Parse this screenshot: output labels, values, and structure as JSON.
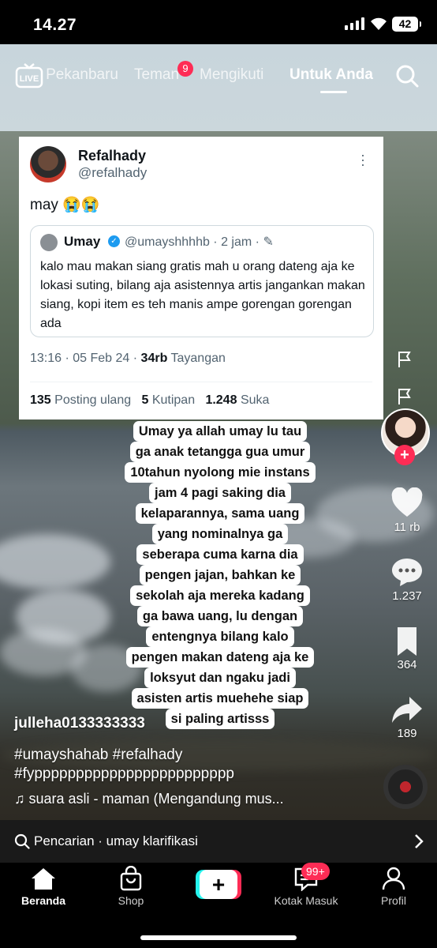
{
  "status": {
    "time": "14.27",
    "battery": "42"
  },
  "top_nav": {
    "live_label": "LIVE",
    "tabs": [
      {
        "label": "Pekanbaru"
      },
      {
        "label": "Teman",
        "badge": "9"
      },
      {
        "label": "Mengikuti"
      },
      {
        "label": "Untuk Anda",
        "active": true
      }
    ]
  },
  "tweet": {
    "name": "Refalhady",
    "handle": "@refalhady",
    "text": "may 😭😭",
    "quote": {
      "name": "Umay",
      "meta": "@umayshhhhb · 2 jam ·",
      "body": "kalo mau makan siang gratis mah u orang dateng aja ke lokasi suting, bilang aja asistennya artis jangankan makan siang, kopi item es teh manis ampe gorengan gorengan ada"
    },
    "time": "13:16 · 05 Feb 24 ·",
    "views_count": "34rb",
    "views_label": "Tayangan",
    "reposts_count": "135",
    "reposts_label": "Posting ulang",
    "quotes_count": "5",
    "quotes_label": "Kutipan",
    "likes_count": "1.248",
    "likes_label": "Suka"
  },
  "caption_lines": [
    "Umay ya allah umay lu tau",
    "ga anak tetangga gua umur",
    "10tahun nyolong mie instans",
    "jam 4 pagi saking dia",
    "kelaparannya, sama uang",
    "yang nominalnya ga",
    "seberapa cuma karna dia",
    "pengen jajan, bahkan ke",
    "sekolah aja mereka kadang",
    "ga bawa uang, lu dengan",
    "entengnya bilang kalo",
    "pengen makan dateng aja ke",
    "loksyut dan ngaku jadi",
    "asisten artis muehehe siap",
    "si paling artisss"
  ],
  "actions": {
    "likes": "11 rb",
    "comments": "1.237",
    "saves": "364",
    "shares": "189"
  },
  "video": {
    "username": "julleha0133333333",
    "hashtags_line1": "#umayshahab #refalhady",
    "hashtags_line2": "#fypppppppppppppppppppppppp",
    "music": "♫ suara asli - maman (Mengandung mus..."
  },
  "search_bar": {
    "text": "Pencarian · umay klarifikasi"
  },
  "bottom_nav": {
    "home": "Beranda",
    "shop": "Shop",
    "inbox": "Kotak Masuk",
    "inbox_badge": "99+",
    "profile": "Profil"
  },
  "colors": {
    "accent": "#fe2c55",
    "cyan": "#25f4ee",
    "twitter_blue": "#1d9bf0"
  }
}
